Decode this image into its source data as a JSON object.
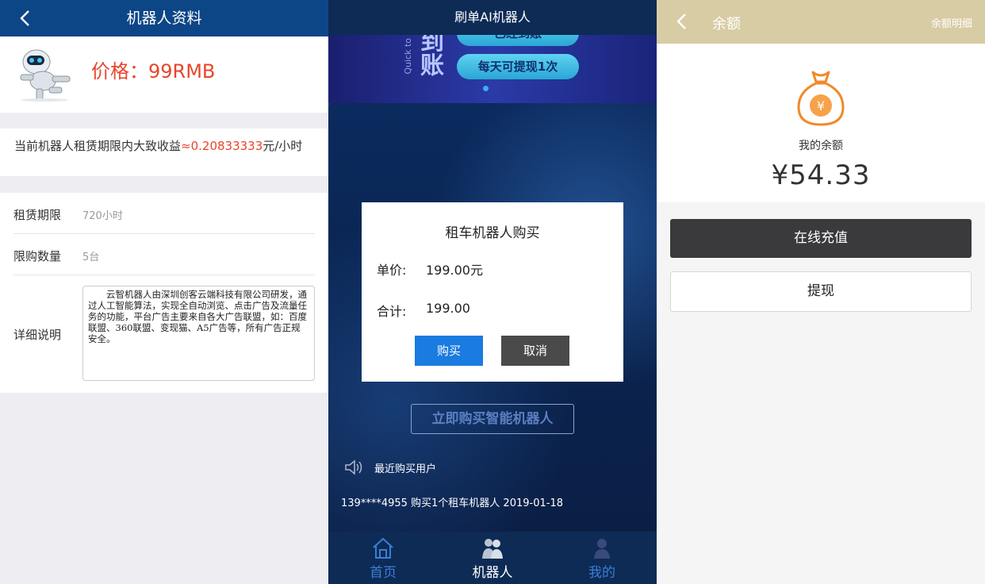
{
  "robot_info": {
    "title": "机器人资料",
    "price_text": "价格：99RMB",
    "income_prefix": "当前机器人租赁期限内大致收益",
    "income_value": "≈0.20833333",
    "income_suffix": "元/小时",
    "rows": [
      {
        "label": "租赁期限",
        "value": "720小时"
      },
      {
        "label": "限购数量",
        "value": "5台"
      }
    ],
    "detail_label": "详细说明",
    "detail_text": "云智机器人由深圳创客云端科技有限公司研发，通过人工智能算法，实现全自动浏览、点击广告及流量任务的功能，平台广告主要来自各大广告联盟，如：百度联盟、360联盟、变现猫、A5广告等，所有广告正规安全。"
  },
  "robot_store": {
    "title": "刷单AI机器人",
    "banner": {
      "big_text": "到账",
      "vertical_text": "Quick to",
      "pill_1": "已经到账",
      "pill_2": "每天可提现1次"
    },
    "buy_button": "立即购买智能机器人",
    "recent_label": "最近购买用户",
    "recent_order": "139****4955 购买1个租车机器人 2019-01-18",
    "modal": {
      "title": "租车机器人购买",
      "unit_price_label": "单价:",
      "unit_price_value": "199.00元",
      "total_label": "合计:",
      "total_value": "199.00",
      "buy_label": "购买",
      "cancel_label": "取消"
    },
    "tabs": [
      {
        "label": "首页",
        "icon": "home-icon"
      },
      {
        "label": "机器人",
        "icon": "robot-group-icon"
      },
      {
        "label": "我的",
        "icon": "user-icon"
      }
    ],
    "active_tab": "机器人"
  },
  "balance": {
    "title": "余额",
    "detail_link": "余额明细",
    "my_balance_label": "我的余额",
    "amount": "¥54.33",
    "recharge_label": "在线充值",
    "withdraw_label": "提现"
  },
  "colors": {
    "header_blue": "#0d4687",
    "price_red": "#e8452a",
    "modal_buy": "#1a7be0",
    "modal_cancel": "#4a4a4a",
    "gold_header": "#d8cca5",
    "bag_orange": "#f0892a"
  }
}
